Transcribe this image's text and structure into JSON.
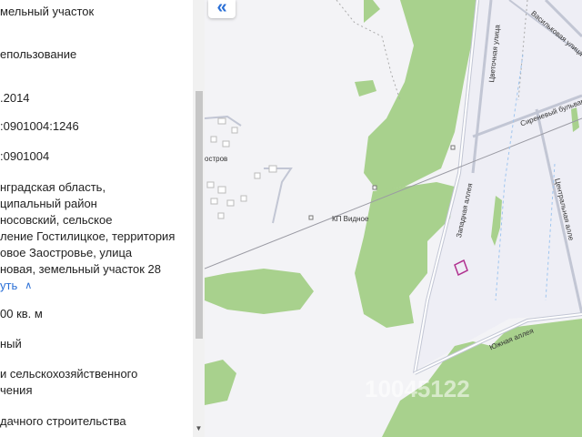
{
  "panel": {
    "fields": [
      {
        "lines": [
          "мельный участок"
        ]
      },
      {
        "lines": [
          "епользование"
        ]
      },
      {
        "lines": [
          ".2014"
        ]
      },
      {
        "lines": [
          ":0901004:1246"
        ]
      },
      {
        "lines": [
          ":0901004"
        ]
      },
      {
        "lines": [
          "нградская область,",
          "ципальный район",
          "носовский, сельское",
          "ление Гостилицкое, территория",
          "овое Заостровье, улица",
          "новая, земельный участок 28"
        ]
      },
      {
        "lines": [
          "00 кв. м"
        ]
      },
      {
        "lines": [
          "ный"
        ]
      },
      {
        "lines": [
          "и сельскохозяйственного",
          "чения"
        ]
      },
      {
        "lines": [
          "дачного строительства"
        ]
      }
    ],
    "collapse_link": "уть"
  },
  "map": {
    "collapse_icon": "«",
    "labels": {
      "vasilkovaya": "Васильковая улица",
      "tsvetochnaya": "Цветочная улица",
      "sirenevy": "Сиреневый бульвар",
      "tsentralnaya": "Центральная алле",
      "zapadnaya": "Западная аллея",
      "yuzhnaya": "Южная аллея",
      "village": "КП Видное",
      "ostrov": "остров"
    },
    "watermark": "10045122",
    "colors": {
      "green": "#a8d18d",
      "road": "#b9bfd1",
      "parcel": "#b0308f"
    }
  }
}
